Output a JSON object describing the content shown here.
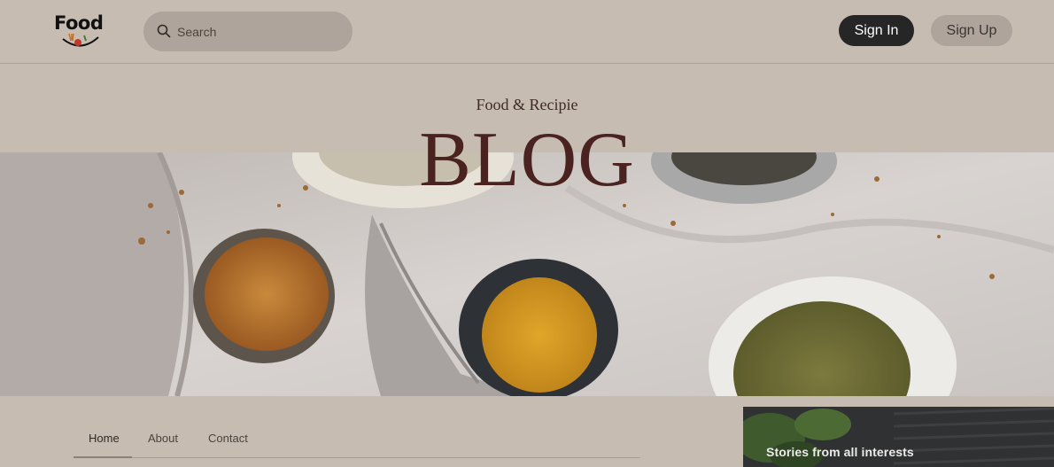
{
  "header": {
    "logo_text": "Food",
    "search": {
      "placeholder": "Search"
    },
    "sign_in_label": "Sign In",
    "sign_up_label": "Sign Up"
  },
  "hero": {
    "subtitle": "Food & Recipie",
    "title": "BLOG"
  },
  "nav": {
    "items": [
      {
        "label": "Home"
      },
      {
        "label": "About"
      },
      {
        "label": "Contact"
      }
    ],
    "active": "Home"
  },
  "side_card": {
    "text": "Stories from all interests"
  },
  "colors": {
    "page_bg": "#c7bcb1",
    "title": "#4a2220",
    "sign_in_bg": "#262626",
    "pill_bg": "#aea49b"
  }
}
